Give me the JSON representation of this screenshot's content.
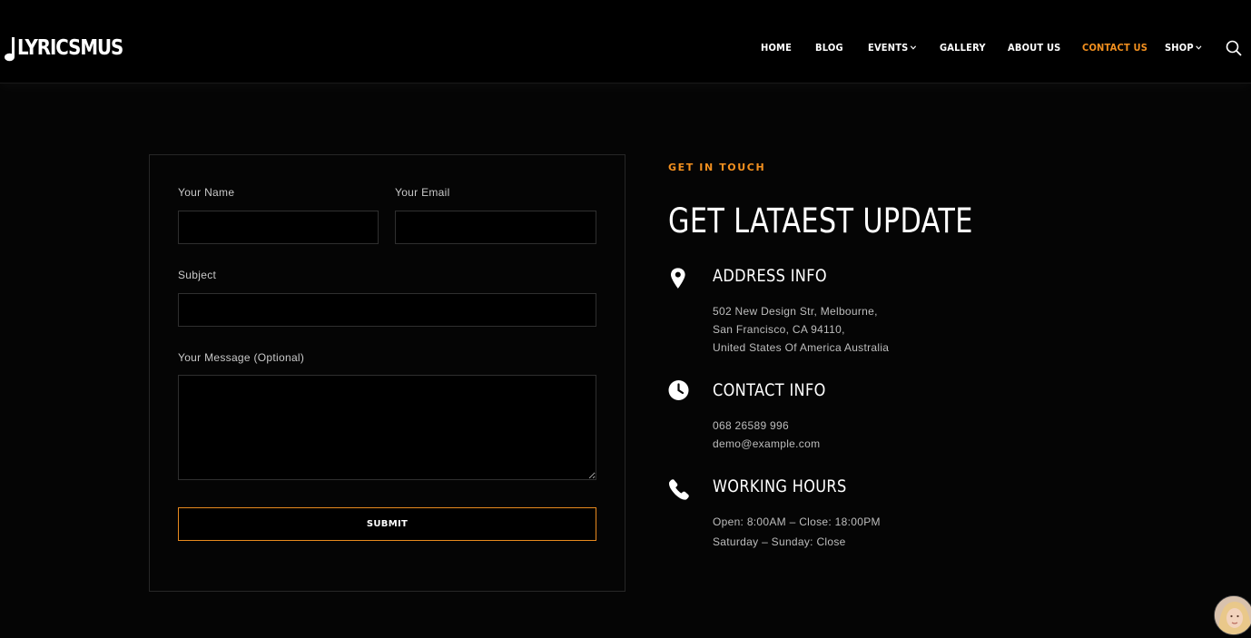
{
  "brand": {
    "name": "LYRICSMUS"
  },
  "nav": {
    "items": [
      {
        "label": "HOME",
        "active": false,
        "dropdown": false
      },
      {
        "label": "BLOG",
        "active": false,
        "dropdown": false
      },
      {
        "label": "EVENTS",
        "active": false,
        "dropdown": true
      },
      {
        "label": "GALLERY",
        "active": false,
        "dropdown": false
      },
      {
        "label": "ABOUT US",
        "active": false,
        "dropdown": false
      },
      {
        "label": "CONTACT US",
        "active": true,
        "dropdown": false
      },
      {
        "label": "SHOP",
        "active": false,
        "dropdown": true
      }
    ],
    "search_icon": "search-icon"
  },
  "form": {
    "name_label": "Your Name",
    "name_value": "",
    "email_label": "Your Email",
    "email_value": "",
    "subject_label": "Subject",
    "subject_value": "",
    "message_label": "Your Message (Optional)",
    "message_value": "",
    "submit_label": "SUBMIT"
  },
  "contact": {
    "eyebrow": "GET IN TOUCH",
    "title": "GET LATAEST UPDATE",
    "address": {
      "icon": "map-pin-icon",
      "title": "ADDRESS INFO",
      "lines": [
        "502 New Design Str, Melbourne,",
        "San Francisco, CA 94110,",
        "United States Of America Australia"
      ]
    },
    "contact_info": {
      "icon": "clock-icon",
      "title": "CONTACT INFO",
      "lines": [
        "068 26589 996",
        "demo@example.com"
      ]
    },
    "hours": {
      "icon": "phone-icon",
      "title": "WORKING HOURS",
      "lines": [
        "Open: 8:00AM – Close: 18:00PM",
        "Saturday – Sunday: Close"
      ]
    }
  },
  "colors": {
    "accent": "#f3901f",
    "background": "#050505",
    "header": "#000000",
    "border": "#2f2f2f",
    "text_muted": "#bdbdbd"
  }
}
